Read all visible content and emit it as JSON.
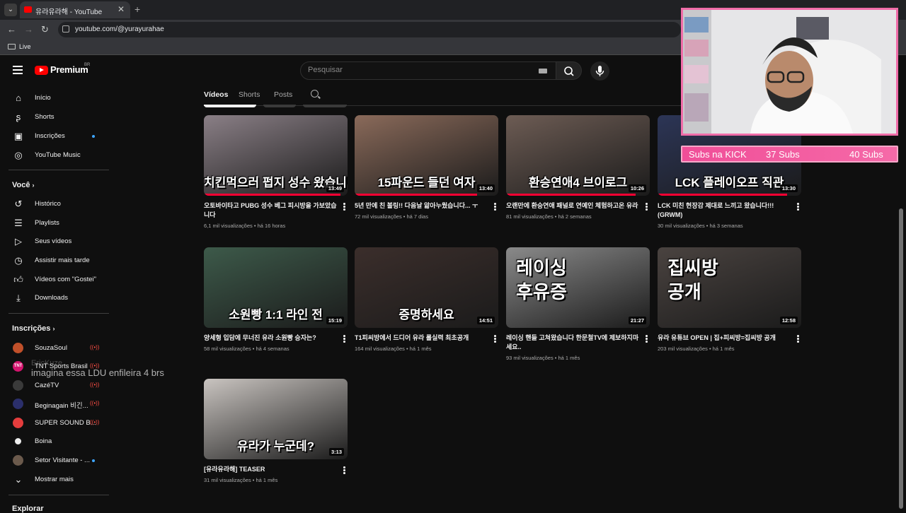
{
  "browser": {
    "tab_title": "유라유라해 - YouTube",
    "url": "youtube.com/@yurayurahae",
    "bookmark": "Live"
  },
  "header": {
    "logo_text": "Premium",
    "logo_country": "BR",
    "search_placeholder": "Pesquisar"
  },
  "sidebar": {
    "main": [
      {
        "label": "Início",
        "icon": "home-icon"
      },
      {
        "label": "Shorts",
        "icon": "shorts-icon"
      },
      {
        "label": "Inscrições",
        "icon": "subscriptions-icon",
        "dot": true
      },
      {
        "label": "YouTube Music",
        "icon": "music-icon"
      }
    ],
    "you_heading": "Você",
    "you": [
      {
        "label": "Histórico",
        "icon": "history-icon"
      },
      {
        "label": "Playlists",
        "icon": "playlists-icon"
      },
      {
        "label": "Seus vídeos",
        "icon": "your-videos-icon"
      },
      {
        "label": "Assistir mais tarde",
        "icon": "watch-later-icon"
      },
      {
        "label": "Vídeos com \"Gostei\"",
        "icon": "like-icon"
      },
      {
        "label": "Downloads",
        "icon": "download-icon"
      }
    ],
    "subs_heading": "Inscrições",
    "subscriptions": [
      {
        "label": "SouzaSoul",
        "live": true,
        "color": "#c0502a"
      },
      {
        "label": "TNT Sports Brasil",
        "live": true,
        "color": "#d4146e",
        "initials": "TNT"
      },
      {
        "label": "CazéTV",
        "live": true,
        "color": "#3a3a3a"
      },
      {
        "label": "Beginagain 비긴...",
        "live": true,
        "color": "#2b2f6b"
      },
      {
        "label": "SUPER SOUND B...",
        "live": true,
        "color": "#e43d3d"
      },
      {
        "label": "Boina",
        "live": false,
        "color": "#eeeeee"
      },
      {
        "label": "Setor Visitante - ...",
        "dot": true,
        "color": "#6b5a4c"
      }
    ],
    "show_more": "Mostrar mais",
    "explore_heading": "Explorar"
  },
  "chat_overlay": {
    "user": "EricKuze",
    "message": "imagina essa LDU enfileira 4 brs"
  },
  "channel_tabs": [
    "Vídeos",
    "Shorts",
    "Posts"
  ],
  "videos": [
    {
      "thumb_text": "치킨먹으러 펍지 성수 왔습니다",
      "duration": "13:49",
      "title": "오토바이타고 PUBG 성수 베그 피시방을 가보았습니다",
      "views": "6,1 mil visualizações",
      "age": "há 16 horas",
      "bg": "#8a7f86",
      "progress": 0.95
    },
    {
      "thumb_text": "15파운드 들던 여자",
      "duration": "13:40",
      "title": "5년 만에 친 볼링!! 다음날 앓아누웠습니다... ㅜ",
      "views": "72 mil visualizações",
      "age": "há 7 dias",
      "bg": "#8a6a5a",
      "progress": 0.85
    },
    {
      "thumb_text": "환승연애4 브이로그",
      "duration": "10:26",
      "title": "오랜만에 환승연애 패널로 연예인 체험하고온 유라",
      "views": "81 mil visualizações",
      "age": "há 2 semanas",
      "bg": "#6d5c54",
      "progress": 0.9
    },
    {
      "thumb_text": "LCK 플레이오프 직관",
      "duration": "13:30",
      "title": "LCK 미친 현장감 제대로 느끼고 왔습니다!!! (GRWM)",
      "views": "30 mil visualizações",
      "age": "há 3 semanas",
      "bg": "#2c3556",
      "progress": 0.9
    },
    {
      "thumb_text": "소원빵 1:1 라인 전",
      "duration": "15:19",
      "title": "양세형 입담에 무너진 유라 소원빵 승자는?",
      "views": "58 mil visualizações",
      "age": "há 4 semanas",
      "bg": "#3d5a4a",
      "progress": 0
    },
    {
      "thumb_text": "증명하세요",
      "duration": "14:51",
      "title": "T1피씨방에서 드디어 유라 롤실력 최초공개",
      "views": "164 mil visualizações",
      "age": "há 1 mês",
      "bg": "#3b2e2b",
      "progress": 0
    },
    {
      "thumb_text": "레이싱\n후유증",
      "duration": "21:27",
      "title": "레이싱 핸들 고쳐왔습니다 한문철TV에 제보하지마세요..",
      "views": "93 mil visualizações",
      "age": "há 1 mês",
      "bg": "#8a8a8a",
      "progress": 0
    },
    {
      "thumb_text": "집씨방\n공개",
      "duration": "12:58",
      "title": "유라 유튜브 OPEN | 집+피씨방=집씨방 공개",
      "views": "203 mil visualizações",
      "age": "há 1 mês",
      "bg": "#4a4340",
      "progress": 0
    },
    {
      "thumb_text": "유라가 누군데?",
      "duration": "3:13",
      "title": "[유라유라해] TEASER",
      "views": "31 mil visualizações",
      "age": "há 1 mês",
      "bg": "#c9c4c0",
      "progress": 0
    }
  ],
  "subs_bar": {
    "label": "Subs na KICK",
    "count": "37 Subs",
    "goal": "40 Subs"
  }
}
